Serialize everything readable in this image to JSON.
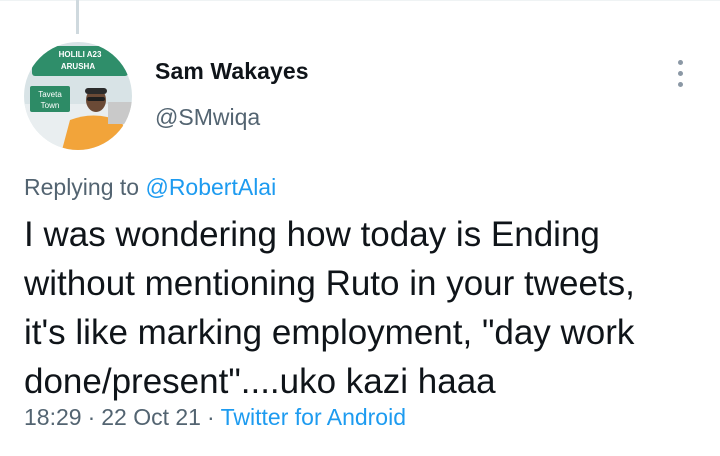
{
  "author": {
    "name": "Sam Wakayes",
    "handle": "@SMwiqa",
    "avatar_sign_text": [
      "HOLILI A23",
      "ARUSHA"
    ],
    "avatar_small_sign_text": [
      "Taveta",
      "Town"
    ]
  },
  "reply": {
    "prefix": "Replying to",
    "to_handle": "@RobertAlai"
  },
  "tweet": {
    "lines": [
      "I was wondering how today is Ending",
      "without mentioning Ruto in your tweets,",
      "it's like marking employment, \"day work",
      "done/present\"....uko kazi haaa"
    ]
  },
  "meta": {
    "time": "18:29",
    "separator": "·",
    "date": "22 Oct 21",
    "source": "Twitter for Android"
  },
  "icons": {
    "more": "more-vertical-icon"
  },
  "colors": {
    "text": "#0f1419",
    "secondary": "#536471",
    "link": "#1d9bf0"
  }
}
